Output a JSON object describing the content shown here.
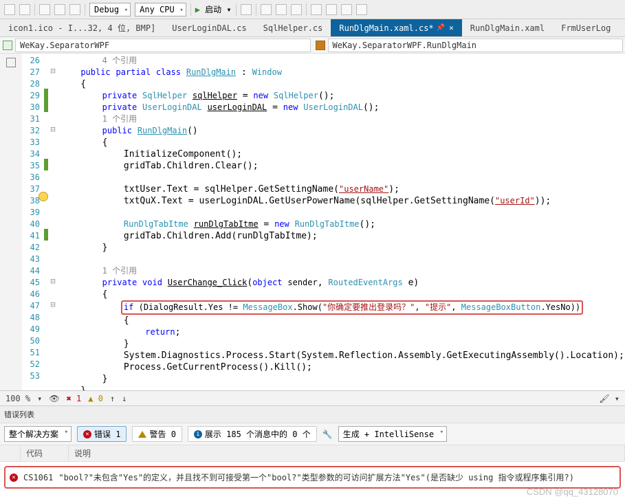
{
  "toolbar": {
    "config": "Debug",
    "platform": "Any CPU",
    "run": "启动"
  },
  "tabs": [
    {
      "label": "icon1.ico - I...32, 4 位, BMP]"
    },
    {
      "label": "UserLoginDAL.cs"
    },
    {
      "label": "SqlHelper.cs"
    },
    {
      "label": "RunDlgMain.xaml.cs*",
      "active": true
    },
    {
      "label": "RunDlgMain.xaml"
    },
    {
      "label": "FrmUserLog"
    }
  ],
  "nav": {
    "left": "WeKay.SeparatorWPF",
    "right": "WeKay.SeparatorWPF.RunDlgMain"
  },
  "lines": {
    "start": 26,
    "end": 53,
    "ref1": "4 个引用",
    "ref2": "1 个引用",
    "ref3": "1 个引用"
  },
  "code": {
    "l26a": "public",
    "l26b": "partial",
    "l26c": "class",
    "l26d": "RunDlgMain",
    "l26e": "Window",
    "l28a": "private",
    "l28b": "SqlHelper",
    "l28c": "sqlHelper",
    "l28d": "new",
    "l28e": "SqlHelper",
    "l28f": "();",
    "l29a": "private",
    "l29b": "UserLoginDAL",
    "l29c": "userLoginDAL",
    "l29d": "new",
    "l29e": "UserLoginDAL",
    "l29f": "();",
    "l30a": "public",
    "l30b": "RunDlgMain",
    "l30c": "()",
    "l32": "InitializeComponent();",
    "l33": "gridTab.Children.Clear();",
    "l35a": "txtUser.Text = sqlHelper.GetSettingName(",
    "l35b": "\"userName\"",
    "l35c": ");",
    "l36a": "txtQuX.Text = userLoginDAL.GetUserPowerName(sqlHelper.GetSettingName(",
    "l36b": "\"userId\"",
    "l36c": "));",
    "l38a": "RunDlgTabItme",
    "l38b": "runDlgTabItme",
    "l38c": "new",
    "l38d": "RunDlgTabItme",
    "l38e": "();",
    "l39": "gridTab.Children.Add(runDlgTabItme);",
    "l42a": "private",
    "l42b": "void",
    "l42c": "UserChange_Click",
    "l42d": "object",
    "l42e": "sender",
    "l42f": "RoutedEventArgs",
    "l42g": "e",
    "l44a": "if",
    "l44b": "(DialogResult.Yes != ",
    "l44c": "MessageBox",
    "l44d": ".Show(",
    "l44e": "\"你确定要推出登录吗？\"",
    "l44f": ", ",
    "l44g": "\"提示\"",
    "l44h": ", ",
    "l44i": "MessageBoxButton",
    "l44j": ".YesNo))",
    "l46": "return",
    "l48": "System.Diagnostics.Process.Start(System.Reflection.Assembly.GetExecutingAssembly().Location);",
    "l49": "Process.GetCurrentProcess().Kill();"
  },
  "status": {
    "zoom": "100 %",
    "err": "1",
    "wrn": "0",
    "up": "↑",
    "dn": "↓"
  },
  "errorlist": {
    "title": "错误列表",
    "scope": "整个解决方案",
    "errLabel": "错误 1",
    "wrnLabel": "警告 0",
    "msgLabel": "展示 185 个消息中的 0 个",
    "build": "生成 + IntelliSense",
    "col_code": "代码",
    "col_desc": "说明",
    "row_code": "CS1061",
    "row_desc": "\"bool?\"未包含\"Yes\"的定义，并且找不到可接受第一个\"bool?\"类型参数的可访问扩展方法\"Yes\"(是否缺少 using 指令或程序集引用?)"
  },
  "watermark": "CSDN @qq_43128070"
}
